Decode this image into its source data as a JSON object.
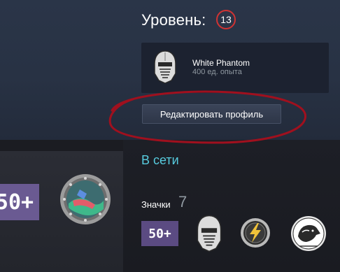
{
  "profile": {
    "level_label": "Уровень:",
    "level_value": "13",
    "level_color": "#d03333"
  },
  "featured_badge": {
    "name": "White Phantom",
    "xp": "400 ед. опыта",
    "icon": "helmet-icon"
  },
  "actions": {
    "edit_profile": "Редактировать профиль"
  },
  "status": {
    "text": "В сети",
    "color": "#57cbde"
  },
  "showcase": {
    "badge_50_text": "50+",
    "showcase_icon": "porthole-icon"
  },
  "badges": {
    "label": "Значки",
    "count": "7",
    "items": [
      {
        "icon": "fifty-plus-badge",
        "text": "50+"
      },
      {
        "icon": "helmet-icon"
      },
      {
        "icon": "lightning-coin-icon"
      },
      {
        "icon": "diamond-dogs-icon"
      }
    ]
  }
}
